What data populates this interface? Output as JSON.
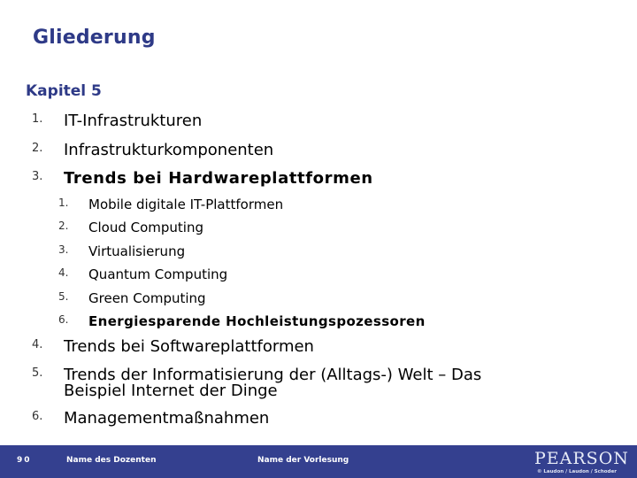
{
  "slide": {
    "title": "Gliederung",
    "chapter": "Kapitel 5",
    "items": [
      {
        "num": "1.",
        "label": "IT-Infrastrukturen",
        "bold": false
      },
      {
        "num": "2.",
        "label": "Infrastrukturkomponenten",
        "bold": false
      },
      {
        "num": "3.",
        "label": "Trends bei Hardwareplattformen",
        "bold": true,
        "subitems": [
          {
            "num": "1.",
            "label": "Mobile digitale IT-Plattformen",
            "bold": false
          },
          {
            "num": "2.",
            "label": "Cloud Computing",
            "bold": false
          },
          {
            "num": "3.",
            "label": "Virtualisierung",
            "bold": false
          },
          {
            "num": "4.",
            "label": "Quantum Computing",
            "bold": false
          },
          {
            "num": "5.",
            "label": "Green Computing",
            "bold": false
          },
          {
            "num": "6.",
            "label": "Energiesparende Hochleistungspozessoren",
            "bold": true
          }
        ]
      },
      {
        "num": "4.",
        "label": "Trends bei Softwareplattformen",
        "bold": false
      },
      {
        "num": "5.",
        "label_line1": "Trends der Informatisierung der (Alltags-) Welt – Das",
        "label_line2": "Beispiel Internet der Dinge",
        "bold": false
      },
      {
        "num": "6.",
        "label": "Managementmaßnahmen",
        "bold": false
      }
    ]
  },
  "footer": {
    "page_number": "90",
    "lecturer": "Name des Dozenten",
    "course": "Name der Vorlesung",
    "brand": "PEARSON",
    "credits": "© Laudon / Laudon / Schoder"
  },
  "colors": {
    "title": "#2e3a87",
    "footer_bg": "#34408f"
  }
}
